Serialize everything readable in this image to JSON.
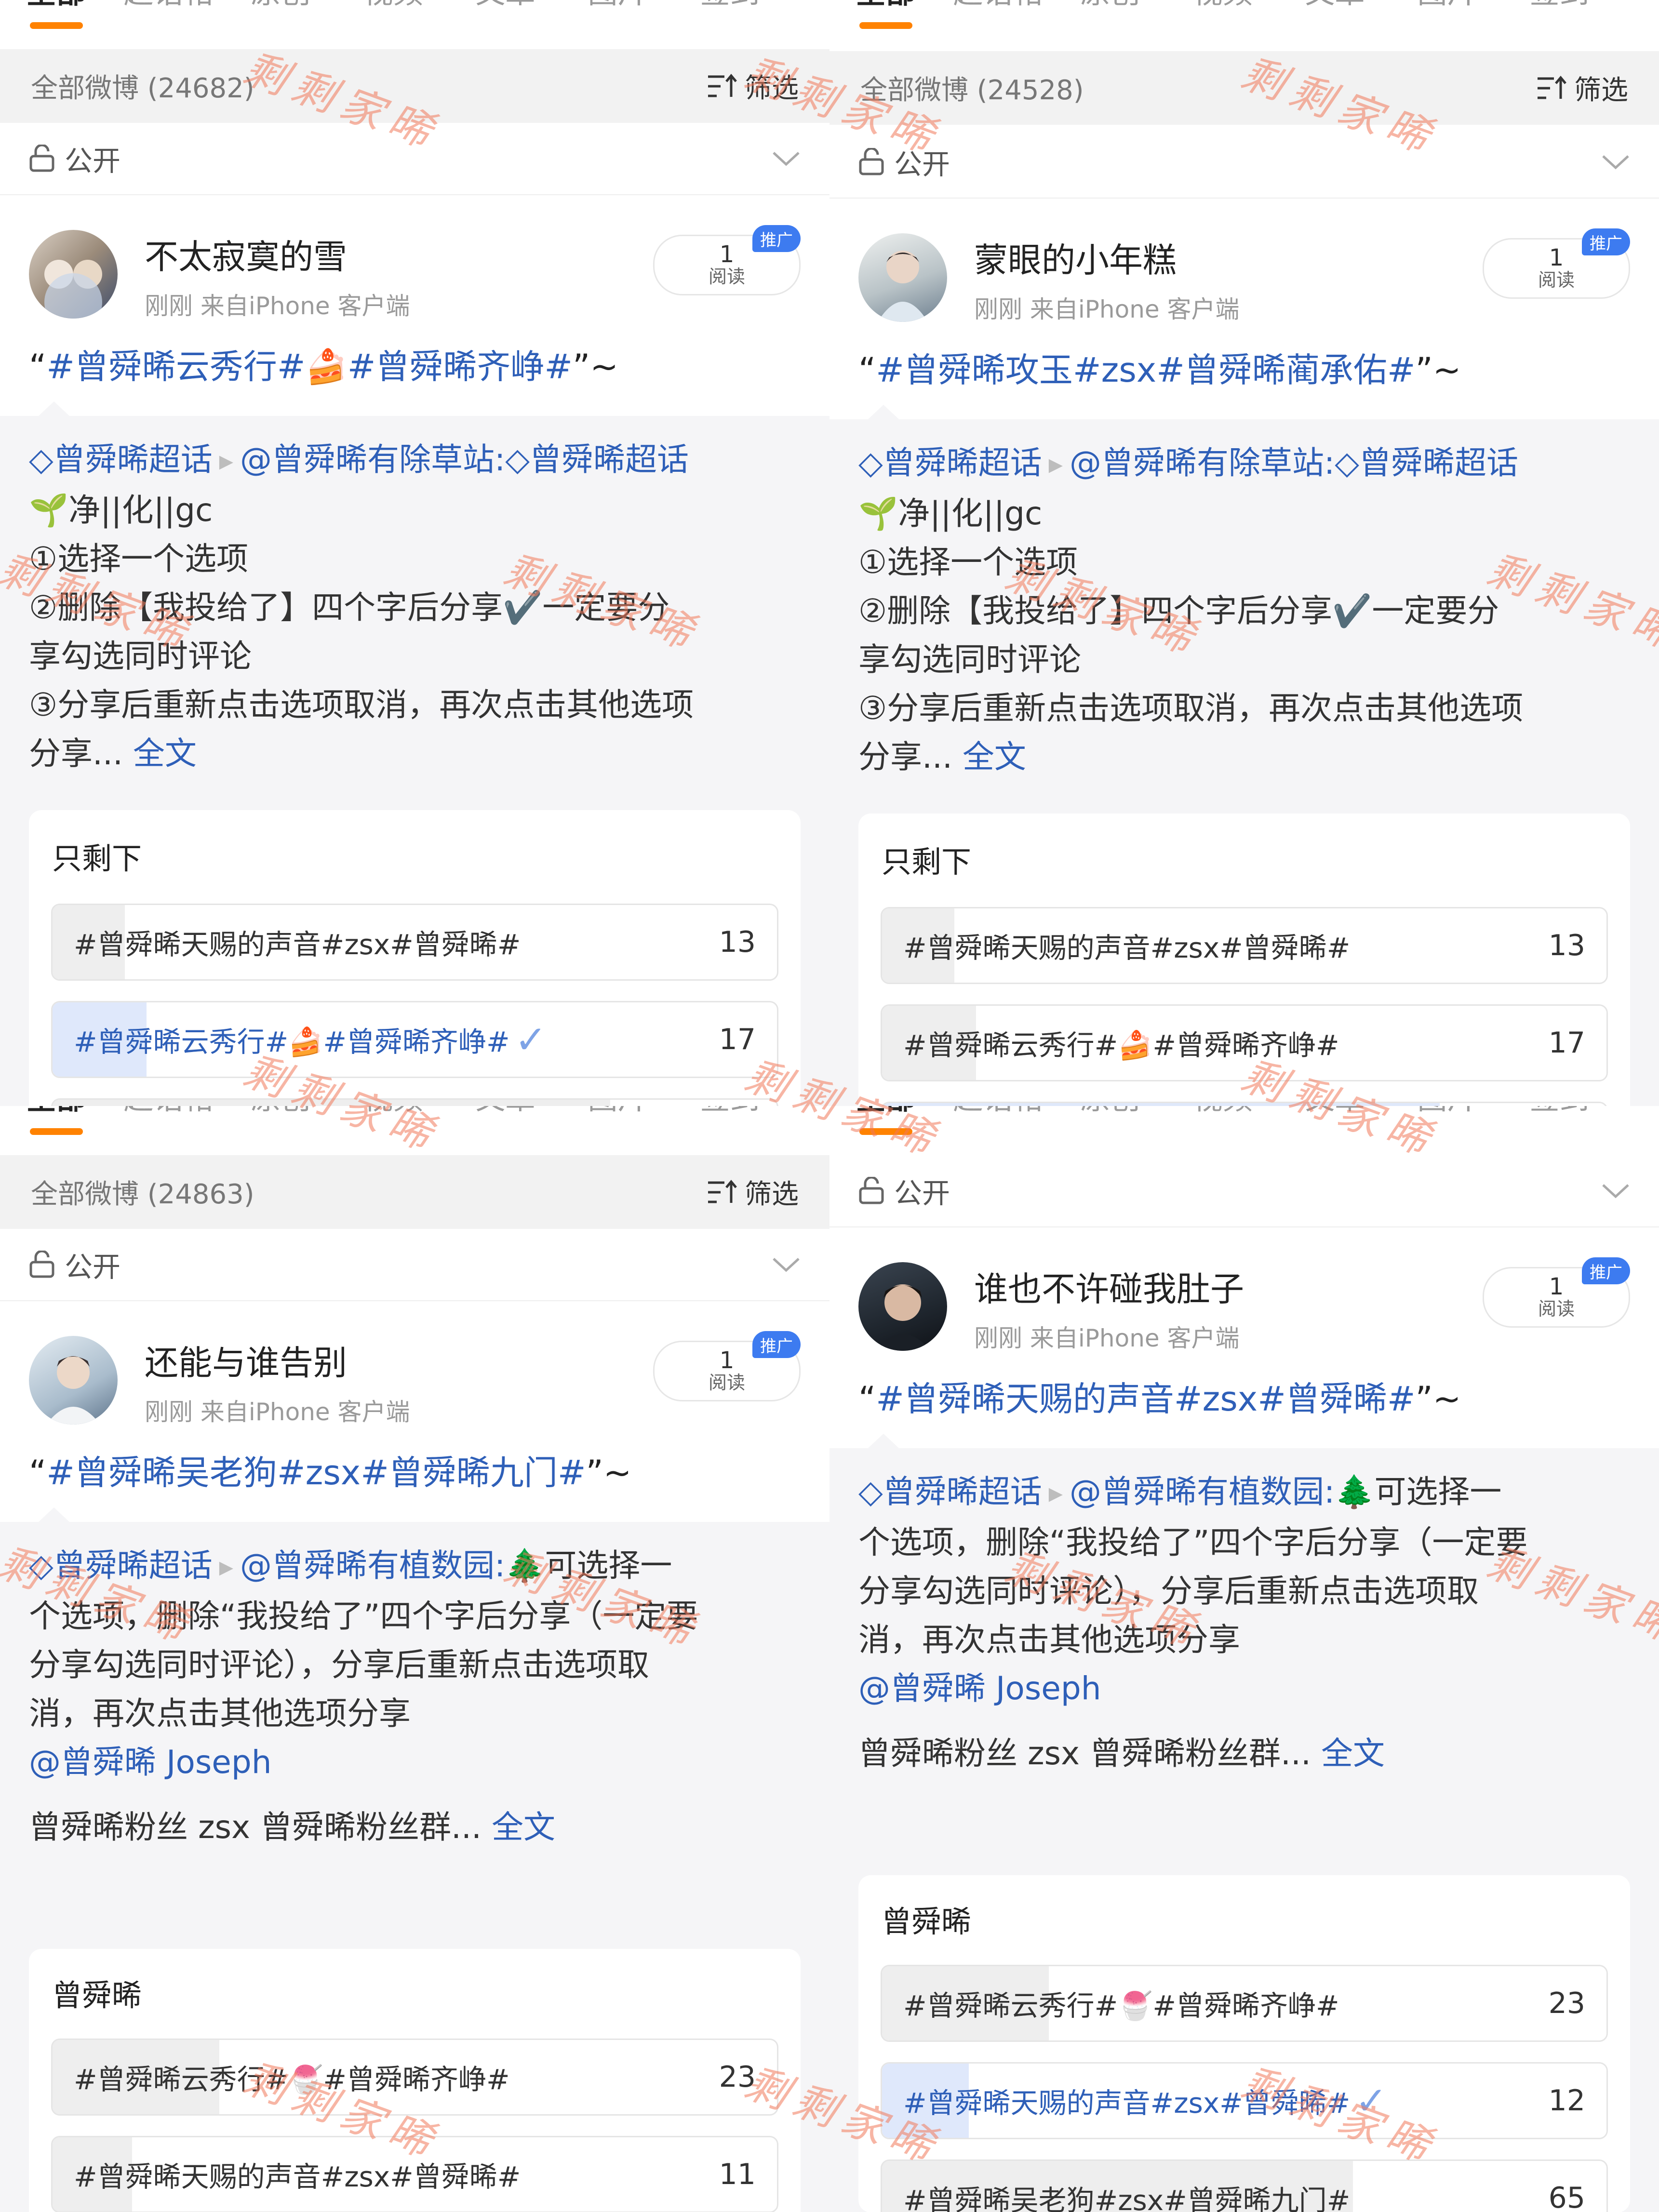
{
  "tabs": [
    "全部",
    "超话帖",
    "原创",
    "视频",
    "文章",
    "图片",
    "签到"
  ],
  "filter_label": "筛选",
  "privacy_label": "公开",
  "read_label": "阅读",
  "promo_label": "推广",
  "watermark": "剩剩家晞",
  "panels": [
    {
      "count": "全部微博 (24682)",
      "user": "不太寂寞的雪",
      "meta": "刚刚  来自iPhone 客户端",
      "reads": "1",
      "title_pre": "“",
      "title_hash": "#曾舜晞云秀行#🍰#曾舜晞齐峥#",
      "title_post": "”~",
      "quote_supertopic": "曾舜晞超话",
      "quote_at": "@曾舜晞有除草站:",
      "quote_supertopic2": "曾舜晞超话",
      "quote_lines": [
        "🌱净||化||gc",
        "①选择一个选项",
        "②删除【我投给了】四个字后分享✔️一定要分",
        "享勾选同时评论",
        "③分享后重新点击选项取消，再次点击其他选项"
      ],
      "quote_tail": "分享... ",
      "fulltext": "全文",
      "poll_question": "只剩下",
      "options": [
        {
          "text": "#曾舜晞天赐的声音#zsx#曾舜晞#",
          "count": "13",
          "fraction": 0.1,
          "chosen": false
        },
        {
          "text": "#曾舜晞云秀行#🍰#曾舜晞齐峥#",
          "count": "17",
          "fraction": 0.13,
          "chosen": true
        },
        {
          "text": "",
          "count": "",
          "fraction": 0.77,
          "chosen": false
        }
      ]
    },
    {
      "count": "全部微博 (24528)",
      "user": "蒙眼的小年糕",
      "meta": "刚刚  来自iPhone 客户端",
      "reads": "1",
      "title_pre": "“",
      "title_hash": "#曾舜晞攻玉#zsx#曾舜晞蔺承佑#",
      "title_post": "”~",
      "quote_supertopic": "曾舜晞超话",
      "quote_at": "@曾舜晞有除草站:",
      "quote_supertopic2": "曾舜晞超话",
      "quote_lines": [
        "🌱净||化||gc",
        "①选择一个选项",
        "②删除【我投给了】四个字后分享✔️一定要分",
        "享勾选同时评论",
        "③分享后重新点击选项取消，再次点击其他选项"
      ],
      "quote_tail": "分享... ",
      "fulltext": "全文",
      "poll_question": "只剩下",
      "options": [
        {
          "text": "#曾舜晞天赐的声音#zsx#曾舜晞#",
          "count": "13",
          "fraction": 0.1,
          "chosen": false
        },
        {
          "text": "#曾舜晞云秀行#🍰#曾舜晞齐峥#",
          "count": "17",
          "fraction": 0.13,
          "chosen": false
        },
        {
          "text": "",
          "count": "",
          "fraction": 0.77,
          "chosen": true
        }
      ]
    },
    {
      "count": "全部微博 (24863)",
      "user": "还能与谁告别",
      "meta": "刚刚  来自iPhone 客户端",
      "reads": "1",
      "title_pre": "“",
      "title_hash": "#曾舜晞吴老狗#zsx#曾舜晞九门#",
      "title_post": "”~",
      "quote_supertopic": "曾舜晞超话",
      "quote_at": "@曾舜晞有植数园:",
      "quote_lines": [
        "🌲可选择一",
        "个选项，删除“我投给了”四个字后分享（一定要",
        "分享勾选同时评论），分享后重新点击选项取",
        "消，再次点击其他选项分享"
      ],
      "quote_mention": "@曾舜晞 Joseph",
      "quote_extra": "曾舜晞粉丝 zsx 曾舜晞粉丝群... ",
      "fulltext": "全文",
      "poll_question": "曾舜晞",
      "options": [
        {
          "text": "#曾舜晞云秀行#🍧#曾舜晞齐峥#",
          "count": "23",
          "fraction": 0.23,
          "chosen": false
        },
        {
          "text": "#曾舜晞天赐的声音#zsx#曾舜晞#",
          "count": "11",
          "fraction": 0.11,
          "chosen": false
        },
        {
          "text": "",
          "count": "",
          "fraction": 0.66,
          "chosen": true
        }
      ]
    },
    {
      "user": "谁也不许碰我肚子",
      "meta": "刚刚  来自iPhone 客户端",
      "reads": "1",
      "title_pre": "“",
      "title_hash": "#曾舜晞天赐的声音#zsx#曾舜晞#",
      "title_post": "”~",
      "quote_supertopic": "曾舜晞超话",
      "quote_at": "@曾舜晞有植数园:",
      "quote_lines": [
        "🌲可选择一",
        "个选项，删除“我投给了”四个字后分享（一定要",
        "分享勾选同时评论），分享后重新点击选项取",
        "消，再次点击其他选项分享"
      ],
      "quote_mention": "@曾舜晞 Joseph",
      "quote_extra": "曾舜晞粉丝 zsx 曾舜晞粉丝群... ",
      "fulltext": "全文",
      "poll_question": "曾舜晞",
      "options": [
        {
          "text": "#曾舜晞云秀行#🍧#曾舜晞齐峥#",
          "count": "23",
          "fraction": 0.23,
          "chosen": false
        },
        {
          "text": "#曾舜晞天赐的声音#zsx#曾舜晞#",
          "count": "12",
          "fraction": 0.12,
          "chosen": true
        },
        {
          "text": "#曾舜晞吴老狗#zsx#曾舜晞九门#",
          "count": "65",
          "fraction": 0.65,
          "chosen": false
        }
      ]
    }
  ],
  "colors": {
    "accent": "#ff8200",
    "link": "#2e5fb8",
    "promo": "#3d7bf0"
  }
}
